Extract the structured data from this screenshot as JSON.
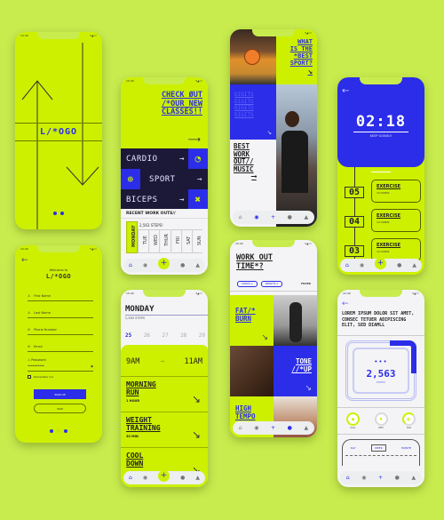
{
  "status_bar": {
    "time": "10:40",
    "icons": "▾◢ ▭"
  },
  "colors": {
    "background": "#c8ec4e",
    "lime": "#ccf000",
    "blue": "#2b2de8",
    "navy": "#1b1838",
    "white": "#f4f4f6"
  },
  "splash": {
    "logo": "L/*OGO",
    "pager_dots": 2
  },
  "classes": {
    "headline": [
      "CHECK ØUT",
      "/*OUR NEW",
      "CLASSES!!"
    ],
    "categories": [
      {
        "label": "CARDIO",
        "icon": "stopwatch-icon",
        "glyph": "◔"
      },
      {
        "label": "SPORT",
        "icon": "basketball-icon",
        "glyph": "⊕"
      },
      {
        "label": "BICEPS",
        "icon": "dumbbell-icon",
        "glyph": "✖"
      }
    ],
    "recent_title": "RECENT WORK OUTS//",
    "steps": "2,563 STEPS!",
    "days": [
      "MONDAY",
      "TUE",
      "WED",
      "THUR",
      "FRI",
      "SAT",
      "SUN"
    ]
  },
  "best_sport": {
    "question": [
      "WHAT",
      "IS THE",
      "*BEST",
      "SPORT?"
    ],
    "repeat_word": [
      "DIGITS",
      "DIGITS",
      "DIGITS",
      "DIGITS"
    ],
    "music": [
      "BEST",
      "WORK",
      "OUT//",
      "MUSIC"
    ]
  },
  "timer": {
    "time": "02:18",
    "subtitle": "KEEP GOING!!",
    "exercises": [
      {
        "num": "05",
        "title": "EXERCISE",
        "detail": "10:00MIN"
      },
      {
        "num": "04",
        "title": "EXERCISE",
        "detail": "10:00MIN"
      },
      {
        "num": "03",
        "title": "EXERCISE",
        "detail": "10:00MIN"
      }
    ]
  },
  "signup": {
    "welcome": "Welcome to",
    "logo": "L/*OGO",
    "fields": [
      {
        "icon": "user-icon",
        "glyph": "♙",
        "placeholder": "First Name"
      },
      {
        "icon": "user-icon",
        "glyph": "♙",
        "placeholder": "Last Name"
      },
      {
        "icon": "phone-icon",
        "glyph": "✆",
        "placeholder": "Phone Number"
      },
      {
        "icon": "mail-icon",
        "glyph": "✉",
        "placeholder": "Email"
      }
    ],
    "password_label": "Password",
    "password_value": "••••••••••",
    "remember": "Remember me",
    "signup_btn": "SIGN UP",
    "skip_btn": "SKIP"
  },
  "schedule": {
    "day": "MONDAY",
    "steps": "2,563 STEPS",
    "dates": [
      "25",
      "26",
      "27",
      "28",
      "29"
    ],
    "time_from": "9AM",
    "time_to": "11AM",
    "workouts": [
      {
        "title": [
          "MORNING",
          "RUN"
        ],
        "duration": "1 HOUR"
      },
      {
        "title": [
          "WEIGHT",
          "TRAINING"
        ],
        "duration": "30 MIN"
      },
      {
        "title": [
          "COOL",
          "DOWN"
        ],
        "duration": ""
      }
    ]
  },
  "workout_time": {
    "title": [
      "WORK OUT",
      "TIME*?"
    ],
    "chips": [
      "CARDIO",
      "WEIGHTS"
    ],
    "filter": "FILTER",
    "tiles": [
      {
        "label": [
          "FAT/*",
          "BURN"
        ]
      },
      {
        "label": [
          "TONE",
          "//*UP"
        ]
      },
      {
        "label": [
          "HIGH",
          "TEMPO"
        ]
      }
    ]
  },
  "stats": {
    "headline": "LOREM IPSUM DOLOR SIT AMET, CONSEC TETUER ADIPISCING ELIT, SED DIAMLL",
    "steps_value": "2,563",
    "steps_label": "STEPS!",
    "steps_progress_pct": 25,
    "rings": [
      {
        "label": "KCAL",
        "glyph": "🔥",
        "progress_pct": 75
      },
      {
        "label": "BPM",
        "glyph": "♥",
        "progress_pct": 40
      },
      {
        "label": "MIN",
        "glyph": "◐",
        "progress_pct": 60
      }
    ],
    "range_tabs": [
      "DAY",
      "WEEK",
      "MONTH"
    ],
    "range_selected": "WEEK"
  }
}
